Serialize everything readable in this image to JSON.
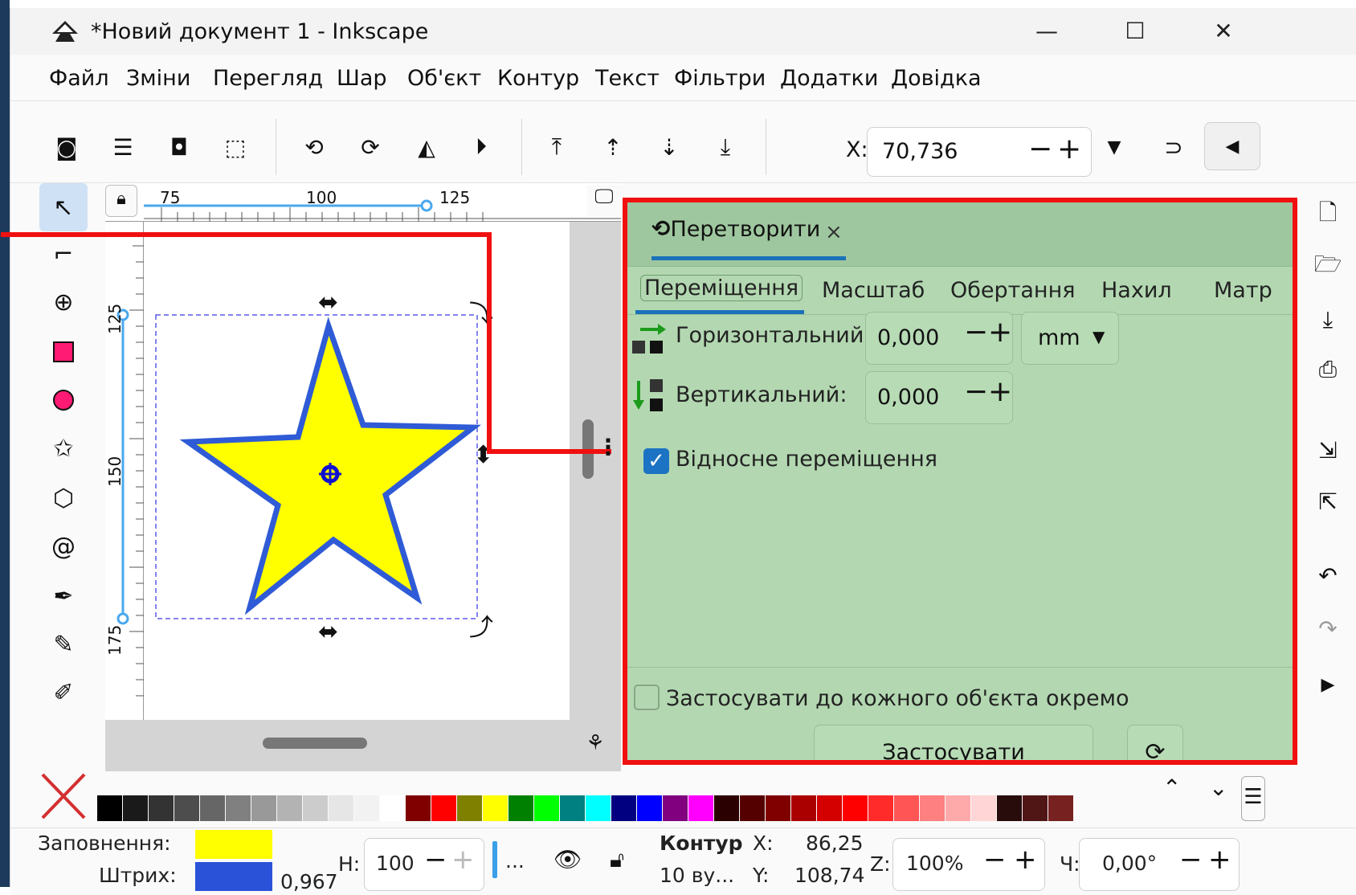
{
  "window": {
    "title": "*Новий документ 1 - Inkscape",
    "controls": {
      "minimize": "—",
      "maximize": "☐",
      "close": "✕"
    }
  },
  "menu": [
    "Файл",
    "Зміни",
    "Перегляд",
    "Шар",
    "Об'єкт",
    "Контур",
    "Текст",
    "Фільтри",
    "Додатки",
    "Довідка"
  ],
  "toolbar": {
    "x_label": "X:",
    "x_value": "70,736",
    "minus": "−",
    "plus": "+"
  },
  "ruler": {
    "top_ticks": [
      "75",
      "100",
      "125"
    ],
    "left_ticks": [
      "125",
      "150",
      "175"
    ]
  },
  "dialog": {
    "tab_label": "Перетворити",
    "tab_close": "×",
    "subtabs": [
      "Переміщення",
      "Масштаб",
      "Обертання",
      "Нахил",
      "Матр"
    ],
    "horizontal_label": "Горизонтальний:",
    "horizontal_value": "0,000",
    "unit": "mm",
    "vertical_label": "Вертикальний:",
    "vertical_value": "0,000",
    "relative_move_label": "Відносне переміщення",
    "relative_move_checked": true,
    "apply_each_label": "Застосувати до кожного об'єкта окремо",
    "apply_each_checked": false,
    "apply_button": "Застосувати"
  },
  "palette": {
    "colors": [
      "#000000",
      "#1a1a1a",
      "#333333",
      "#4d4d4d",
      "#666666",
      "#808080",
      "#999999",
      "#b3b3b3",
      "#cccccc",
      "#e6e6e6",
      "#f2f2f2",
      "#ffffff",
      "#800000",
      "#ff0000",
      "#808000",
      "#ffff00",
      "#008000",
      "#00ff00",
      "#008080",
      "#00ffff",
      "#000080",
      "#0000ff",
      "#800080",
      "#ff00ff",
      "#2b0000",
      "#550000",
      "#800000",
      "#aa0000",
      "#d40000",
      "#ff0000",
      "#ff2a2a",
      "#ff5555",
      "#ff8080",
      "#ffaaaa",
      "#ffd5d5",
      "#280b0b",
      "#501616",
      "#782121"
    ]
  },
  "status": {
    "fill_label": "Заповнення:",
    "stroke_label": "Штрих:",
    "fill_color": "#ffff00",
    "stroke_color": "#2a52d8",
    "stroke_width": "0,967",
    "h_label": "Н:",
    "h_value": "100",
    "layer_dots": "...",
    "object_type": "Контур",
    "object_nodes": "10 ву...",
    "x_label": "X:",
    "x_value": "86,25",
    "y_label": "Y:",
    "y_value": "108,74",
    "z_label": "Z:",
    "zoom": "100%",
    "r_label": "Ч:",
    "rotation": "0,00°"
  }
}
